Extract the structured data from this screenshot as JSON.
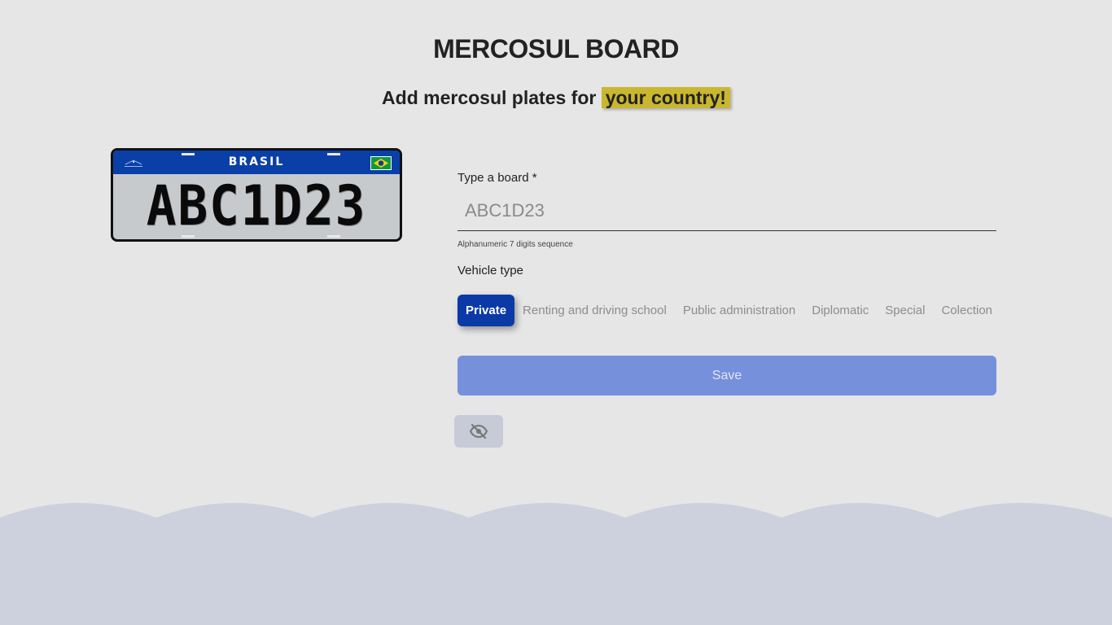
{
  "header": {
    "title": "MERCOSUL BOARD",
    "subtitle_prefix": "Add mercosul plates for",
    "subtitle_highlight": "your country!"
  },
  "plate": {
    "country": "BRASIL",
    "number": "ABC1D23",
    "header_color": "#0a3fa8",
    "body_color": "#c6cacd"
  },
  "form": {
    "board_label": "Type a board *",
    "board_placeholder": "ABC1D23",
    "board_value": "",
    "board_helper": "Alphanumeric 7 digits sequence",
    "vehicle_type_label": "Vehicle type",
    "vehicle_types": [
      {
        "label": "Private",
        "selected": true
      },
      {
        "label": "Renting and driving school",
        "selected": false
      },
      {
        "label": "Public administration",
        "selected": false
      },
      {
        "label": "Diplomatic",
        "selected": false
      },
      {
        "label": "Special",
        "selected": false
      },
      {
        "label": "Colection",
        "selected": false
      }
    ],
    "save_label": "Save"
  },
  "visibility_toggle": {
    "icon": "eye-slash-icon"
  },
  "colors": {
    "background": "#e6e6e6",
    "accent": "#0b3aa6",
    "save_button": "#7690dc",
    "highlight": "#c9b72f",
    "waves": "#cdd1dd"
  }
}
